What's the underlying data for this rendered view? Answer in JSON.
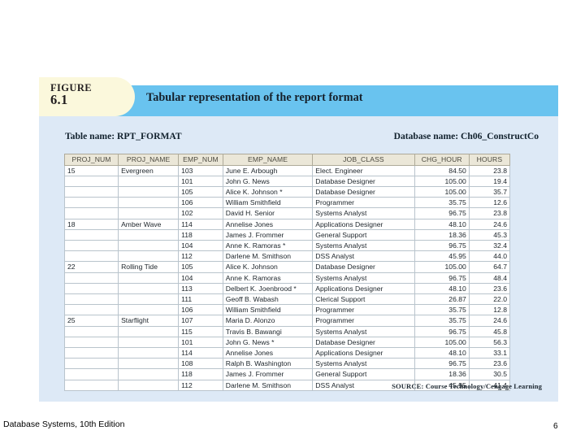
{
  "figure": {
    "label_word": "FIGURE",
    "label_number": "6.1",
    "title": "Tabular representation of the report format",
    "banner_color": "#69c3ef",
    "tab_color": "#fbf8dc",
    "panel_color": "#dde9f6"
  },
  "panel": {
    "table_name": "Table name: RPT_FORMAT",
    "database_name": "Database name: Ch06_ConstructCo",
    "source": "SOURCE: Course Technology/Cengage Learning"
  },
  "table": {
    "columns": [
      "PROJ_NUM",
      "PROJ_NAME",
      "EMP_NUM",
      "EMP_NAME",
      "JOB_CLASS",
      "CHG_HOUR",
      "HOURS"
    ],
    "rows": [
      {
        "group_start": true,
        "proj_num": "15",
        "proj_name": "Evergreen",
        "emp_num": "103",
        "emp_name": "June E. Arbough",
        "job_class": "Elect. Engineer",
        "chg_hour": "84.50",
        "hours": "23.8"
      },
      {
        "group_start": false,
        "proj_num": "",
        "proj_name": "",
        "emp_num": "101",
        "emp_name": "John G. News",
        "job_class": "Database Designer",
        "chg_hour": "105.00",
        "hours": "19.4"
      },
      {
        "group_start": false,
        "proj_num": "",
        "proj_name": "",
        "emp_num": "105",
        "emp_name": "Alice K. Johnson *",
        "job_class": "Database Designer",
        "chg_hour": "105.00",
        "hours": "35.7"
      },
      {
        "group_start": false,
        "proj_num": "",
        "proj_name": "",
        "emp_num": "106",
        "emp_name": "William Smithfield",
        "job_class": "Programmer",
        "chg_hour": "35.75",
        "hours": "12.6"
      },
      {
        "group_start": false,
        "proj_num": "",
        "proj_name": "",
        "emp_num": "102",
        "emp_name": "David H. Senior",
        "job_class": "Systems Analyst",
        "chg_hour": "96.75",
        "hours": "23.8"
      },
      {
        "group_start": true,
        "proj_num": "18",
        "proj_name": "Amber Wave",
        "emp_num": "114",
        "emp_name": "Annelise Jones",
        "job_class": "Applications Designer",
        "chg_hour": "48.10",
        "hours": "24.6"
      },
      {
        "group_start": false,
        "proj_num": "",
        "proj_name": "",
        "emp_num": "118",
        "emp_name": "James J. Frommer",
        "job_class": "General Support",
        "chg_hour": "18.36",
        "hours": "45.3"
      },
      {
        "group_start": false,
        "proj_num": "",
        "proj_name": "",
        "emp_num": "104",
        "emp_name": "Anne K. Ramoras *",
        "job_class": "Systems Analyst",
        "chg_hour": "96.75",
        "hours": "32.4"
      },
      {
        "group_start": false,
        "proj_num": "",
        "proj_name": "",
        "emp_num": "112",
        "emp_name": "Darlene M. Smithson",
        "job_class": "DSS Analyst",
        "chg_hour": "45.95",
        "hours": "44.0"
      },
      {
        "group_start": true,
        "proj_num": "22",
        "proj_name": "Rolling Tide",
        "emp_num": "105",
        "emp_name": "Alice K. Johnson",
        "job_class": "Database Designer",
        "chg_hour": "105.00",
        "hours": "64.7"
      },
      {
        "group_start": false,
        "proj_num": "",
        "proj_name": "",
        "emp_num": "104",
        "emp_name": "Anne K. Ramoras",
        "job_class": "Systems Analyst",
        "chg_hour": "96.75",
        "hours": "48.4"
      },
      {
        "group_start": false,
        "proj_num": "",
        "proj_name": "",
        "emp_num": "113",
        "emp_name": "Delbert K. Joenbrood *",
        "job_class": "Applications Designer",
        "chg_hour": "48.10",
        "hours": "23.6"
      },
      {
        "group_start": false,
        "proj_num": "",
        "proj_name": "",
        "emp_num": "111",
        "emp_name": "Geoff B. Wabash",
        "job_class": "Clerical Support",
        "chg_hour": "26.87",
        "hours": "22.0"
      },
      {
        "group_start": false,
        "proj_num": "",
        "proj_name": "",
        "emp_num": "106",
        "emp_name": "William Smithfield",
        "job_class": "Programmer",
        "chg_hour": "35.75",
        "hours": "12.8"
      },
      {
        "group_start": true,
        "proj_num": "25",
        "proj_name": "Starflight",
        "emp_num": "107",
        "emp_name": "Maria D. Alonzo",
        "job_class": "Programmer",
        "chg_hour": "35.75",
        "hours": "24.6"
      },
      {
        "group_start": false,
        "proj_num": "",
        "proj_name": "",
        "emp_num": "115",
        "emp_name": "Travis B. Bawangi",
        "job_class": "Systems Analyst",
        "chg_hour": "96.75",
        "hours": "45.8"
      },
      {
        "group_start": false,
        "proj_num": "",
        "proj_name": "",
        "emp_num": "101",
        "emp_name": "John G. News *",
        "job_class": "Database Designer",
        "chg_hour": "105.00",
        "hours": "56.3"
      },
      {
        "group_start": false,
        "proj_num": "",
        "proj_name": "",
        "emp_num": "114",
        "emp_name": "Annelise Jones",
        "job_class": "Applications Designer",
        "chg_hour": "48.10",
        "hours": "33.1"
      },
      {
        "group_start": false,
        "proj_num": "",
        "proj_name": "",
        "emp_num": "108",
        "emp_name": "Ralph B. Washington",
        "job_class": "Systems Analyst",
        "chg_hour": "96.75",
        "hours": "23.6"
      },
      {
        "group_start": false,
        "proj_num": "",
        "proj_name": "",
        "emp_num": "118",
        "emp_name": "James J. Frommer",
        "job_class": "General Support",
        "chg_hour": "18.36",
        "hours": "30.5"
      },
      {
        "group_start": false,
        "proj_num": "",
        "proj_name": "",
        "emp_num": "112",
        "emp_name": "Darlene M. Smithson",
        "job_class": "DSS Analyst",
        "chg_hour": "45.95",
        "hours": "41.4"
      }
    ]
  },
  "slide": {
    "footer_text": "Database Systems, 10th Edition",
    "number": "6"
  }
}
